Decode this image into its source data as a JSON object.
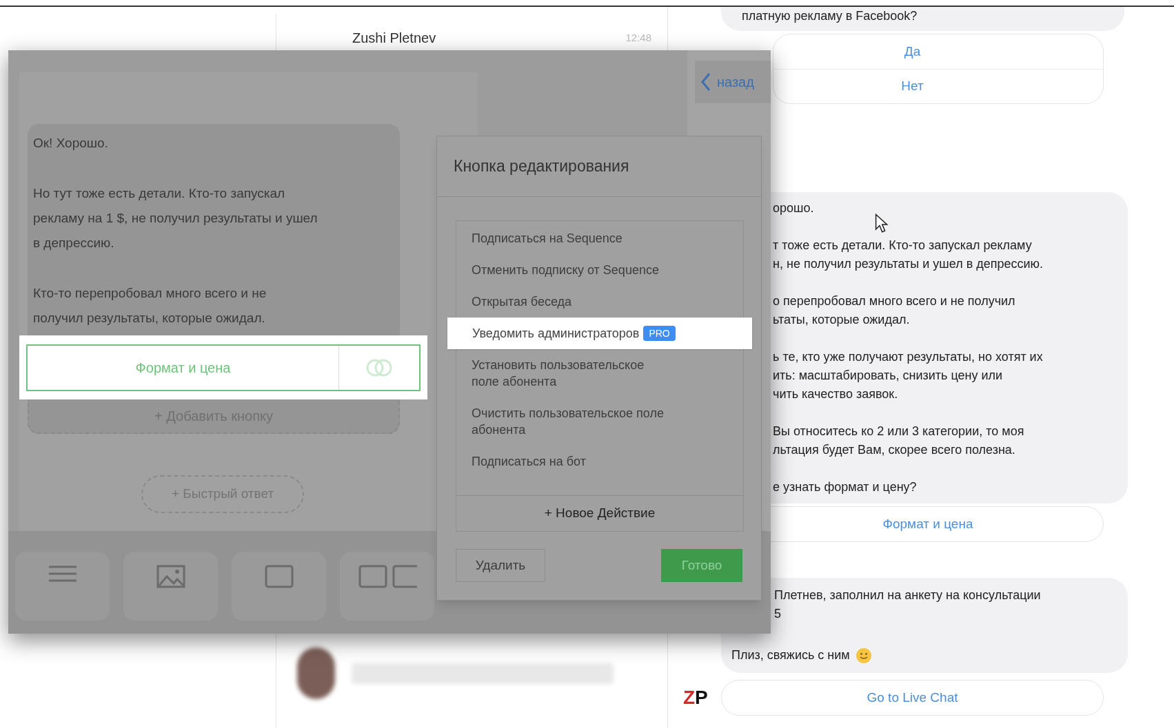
{
  "contacts": [
    {
      "name": "Zushi Pletnev",
      "time": "12:48"
    }
  ],
  "chat": {
    "messages": [
      {
        "kind": "bubble",
        "paragraphs": [
          [
            "платную рекламу в Facebook?"
          ]
        ]
      },
      {
        "kind": "buttons",
        "labels": [
          "Да",
          "Нет"
        ]
      },
      {
        "kind": "bubble",
        "paragraphs": [
          [
            "орошо."
          ],
          [
            "т тоже есть детали. Кто-то запускал рекламу",
            "н, не получил результаты и ушел в депрессию."
          ],
          [
            "о перепробовал много всего и не получил",
            "ьтаты, которые ожидал."
          ],
          [
            "ь те, кто уже получают результаты, но хотят их",
            "ить: масштабировать, снизить цену или",
            "чить качество заявок."
          ],
          [
            "Вы относитесь ко 2 или 3 категории, то моя",
            "льтация будет Вам, скорее всего полезна."
          ],
          [
            "е узнать формат и цену?"
          ]
        ]
      },
      {
        "kind": "buttons",
        "labels": [
          "Формат и цена"
        ]
      },
      {
        "kind": "bubble",
        "paragraphs": [
          [
            "Плетнев, заполнил на анкету на консультации",
            "5"
          ],
          [
            "Плиз, свяжись с ним"
          ]
        ],
        "emoji": true
      },
      {
        "kind": "buttons",
        "labels": [
          "Go to Live Chat"
        ],
        "avatar": [
          "Z",
          "P"
        ]
      }
    ]
  },
  "editor": {
    "back": "назад",
    "message": [
      [
        "Ок! Хорошо."
      ],
      [
        "Но тут тоже есть детали. Кто-то запускал",
        "рекламу на 1 $, не получил результаты и ушел",
        "в депрессию."
      ],
      [
        "Кто-то перепробовал много всего и не",
        "получил результаты, которые ожидал."
      ]
    ],
    "button": {
      "label": "Формат и цена",
      "highlighted": true
    },
    "add_button": "+ Добавить кнопку",
    "quick_reply": "+ Быстрый ответ",
    "toolbar": [
      {
        "kind": "text"
      },
      {
        "kind": "image"
      },
      {
        "kind": "card"
      },
      {
        "kind": "gallery"
      }
    ]
  },
  "dialog": {
    "title": "Кнопка редактирования",
    "actions": [
      {
        "lines": [
          "Подписаться на Sequence"
        ],
        "selected": false
      },
      {
        "lines": [
          "Отменить подписку от Sequence"
        ],
        "selected": false
      },
      {
        "lines": [
          "Открытая беседа"
        ],
        "selected": false
      },
      {
        "lines": [
          "Уведомить администраторов"
        ],
        "badge": "PRO",
        "selected": true
      },
      {
        "lines": [
          "Установить пользовательское",
          "поле абонента"
        ],
        "selected": false
      },
      {
        "lines": [
          "Очистить пользовательское поле",
          "абонента"
        ],
        "selected": false
      },
      {
        "lines": [
          "Подписаться на бот"
        ],
        "selected": false
      }
    ],
    "new_action": "+ Новое Действие",
    "delete": "Удалить",
    "done": "Готово"
  }
}
